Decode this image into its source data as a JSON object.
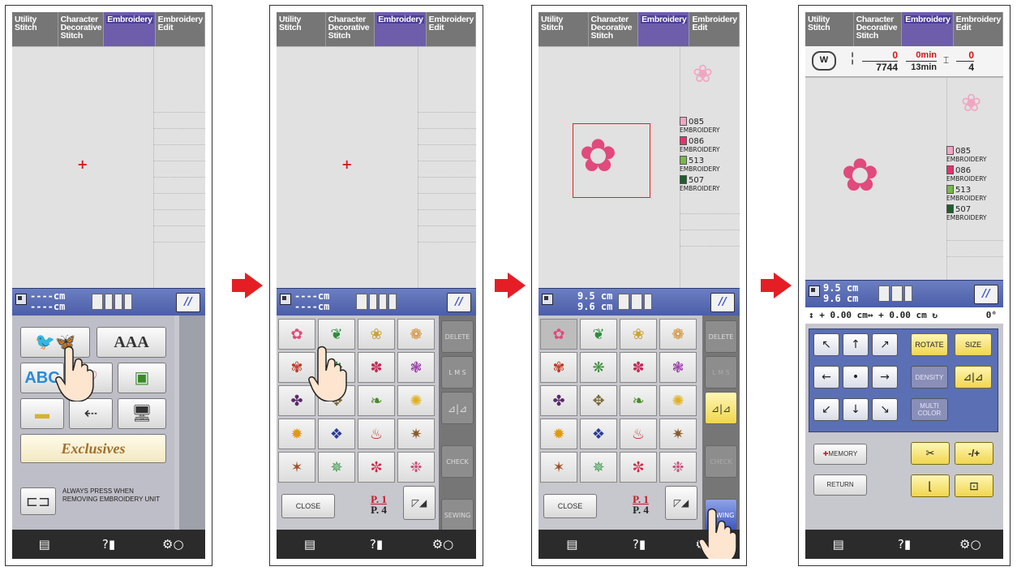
{
  "tabs": [
    "Utility\nStitch",
    "Character\nDecorative\nStitch",
    "Embroidery",
    "Embroidery\nEdit"
  ],
  "tab_active": "Embroidery",
  "size_unset": {
    "h": "----cm",
    "w": "----cm"
  },
  "size_set": {
    "h": "9.5 cm",
    "w": "9.6 cm"
  },
  "categories": {
    "font_sample": "AAA",
    "exclusives": "Exclusives",
    "remove_unit_notice": "ALWAYS PRESS WHEN REMOVING EMBROIDERY UNIT"
  },
  "side_buttons": {
    "delete": "DELETE",
    "lms": "L M S",
    "check": "CHECK",
    "sewing": "SEWING"
  },
  "close_label": "CLOSE",
  "page": {
    "current": "P. 1",
    "total": "P. 4"
  },
  "threads": [
    {
      "code": "085",
      "label": "EMBROIDERY",
      "color": "#f0a6c3"
    },
    {
      "code": "086",
      "label": "EMBROIDERY",
      "color": "#e4336e"
    },
    {
      "code": "513",
      "label": "EMBROIDERY",
      "color": "#78b84a"
    },
    {
      "code": "507",
      "label": "EMBROIDERY",
      "color": "#1e5e2e"
    }
  ],
  "sewing_screen": {
    "presser_foot": "W",
    "stitch_count": "0",
    "stitch_total": "7744",
    "time": "0min",
    "time_total": "13min",
    "color_count": "0",
    "color_total": "4",
    "offset_v": "+ 0.00 cm",
    "offset_h": "+ 0.00 cm",
    "angle": "0°",
    "rotate": "ROTATE",
    "size": "SIZE",
    "density": "DENSITY",
    "multi_color": "MULTI COLOR",
    "memory": "MEMORY",
    "return": "RETURN",
    "needle_pos": "-/+"
  },
  "colors": {
    "accent_tab": "#6e5dab",
    "arrow": "#e51e25",
    "size_bar": "#5b6fb5"
  }
}
